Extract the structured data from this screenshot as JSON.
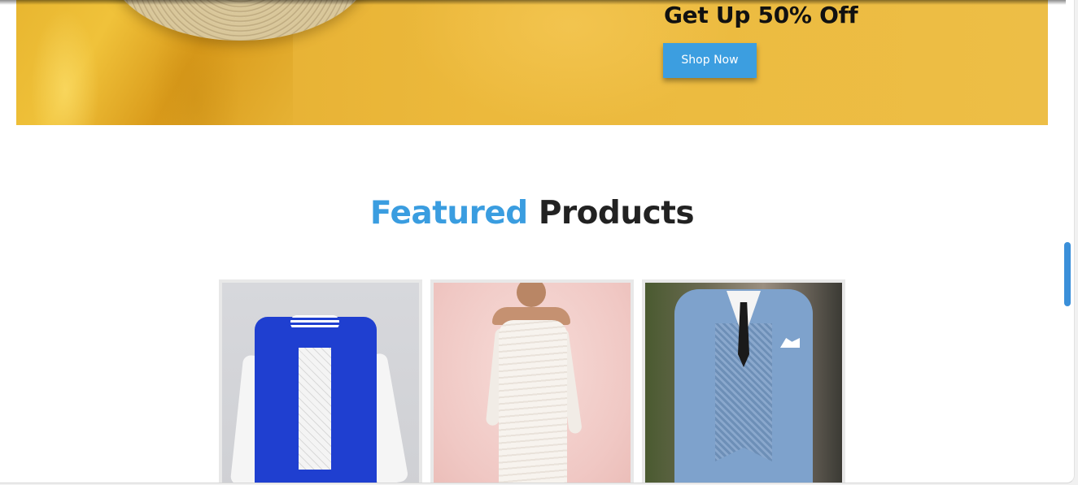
{
  "hero": {
    "title": "Get Up 50% Off",
    "cta_label": "Shop Now"
  },
  "featured": {
    "title_accent": "Featured",
    "title_rest": "Products"
  },
  "products": [
    {
      "image": "varsity-jacket-image"
    },
    {
      "image": "white-dress-image"
    },
    {
      "image": "blue-suit-image"
    }
  ],
  "colors": {
    "accent": "#3a9de0",
    "button": "#3c9ee0",
    "banner": "#ecb93c",
    "heading_dark": "#222222"
  }
}
